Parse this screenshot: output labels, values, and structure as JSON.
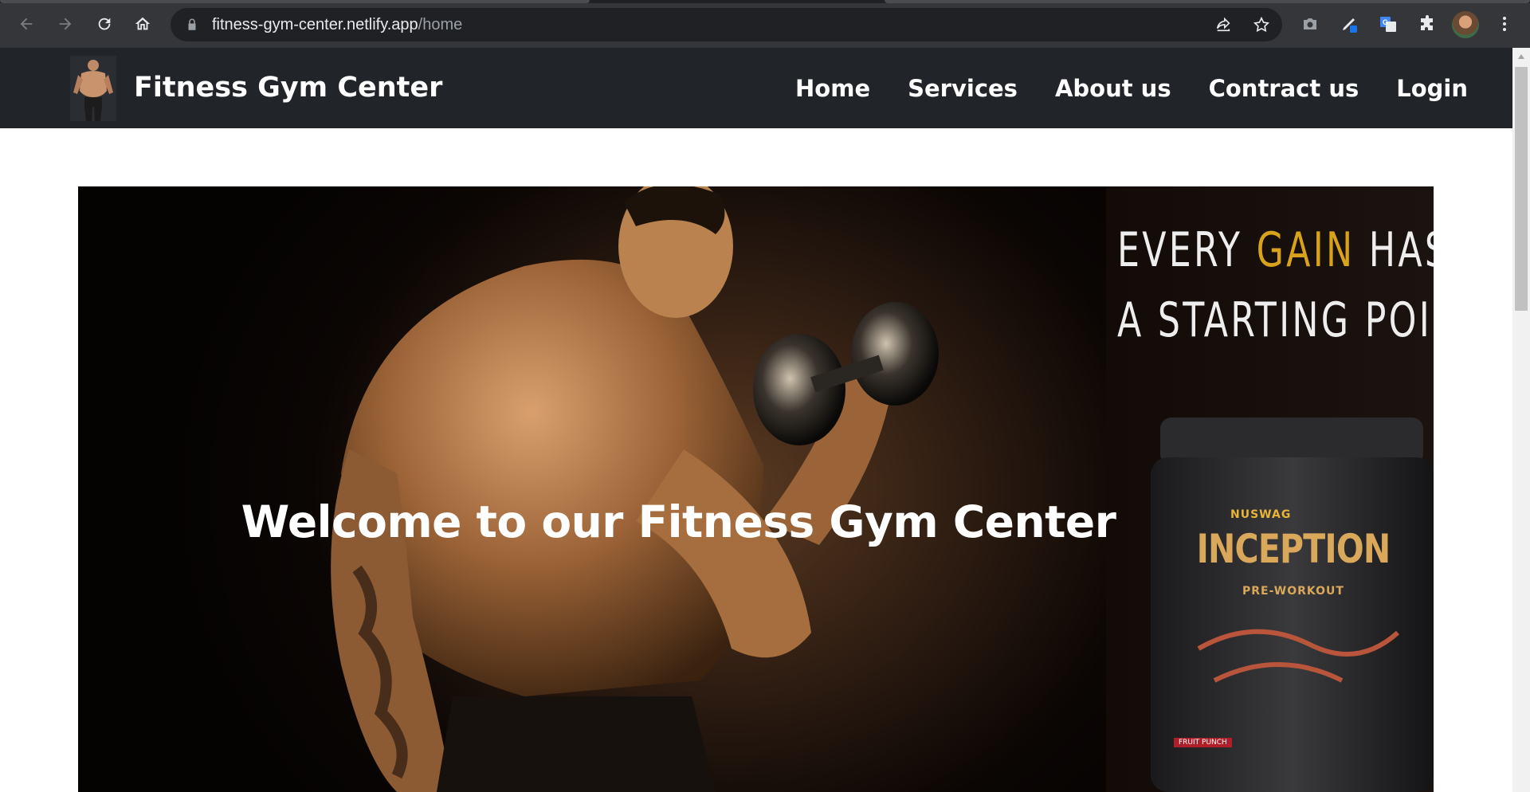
{
  "browser": {
    "url_host": "fitness-gym-center.netlify.app",
    "url_path": "/home"
  },
  "site": {
    "brand": "Fitness Gym Center",
    "nav": [
      {
        "label": "Home"
      },
      {
        "label": "Services"
      },
      {
        "label": "About us"
      },
      {
        "label": "Contract us"
      },
      {
        "label": "Login"
      }
    ]
  },
  "hero": {
    "title": "Welcome to our Fitness Gym Center",
    "promo_line1_a": "EVERY ",
    "promo_line1_accent": "GAIN",
    "promo_line1_b": " HAS",
    "promo_line2": "A STARTING POI",
    "product_brand": "NUSWAG",
    "product_name": "INCEPTION",
    "product_sub": "PRE-WORKOUT",
    "product_flavor": "FRUIT PUNCH"
  },
  "colors": {
    "navbar": "#212529",
    "chrome": "#35363a",
    "accent_gold": "#d9a21b"
  },
  "icons": [
    "back-arrow-icon",
    "forward-arrow-icon",
    "reload-icon",
    "home-icon",
    "lock-icon",
    "share-icon",
    "star-icon",
    "camera-icon",
    "pen-icon",
    "translate-icon",
    "puzzle-icon",
    "kebab-menu-icon"
  ]
}
